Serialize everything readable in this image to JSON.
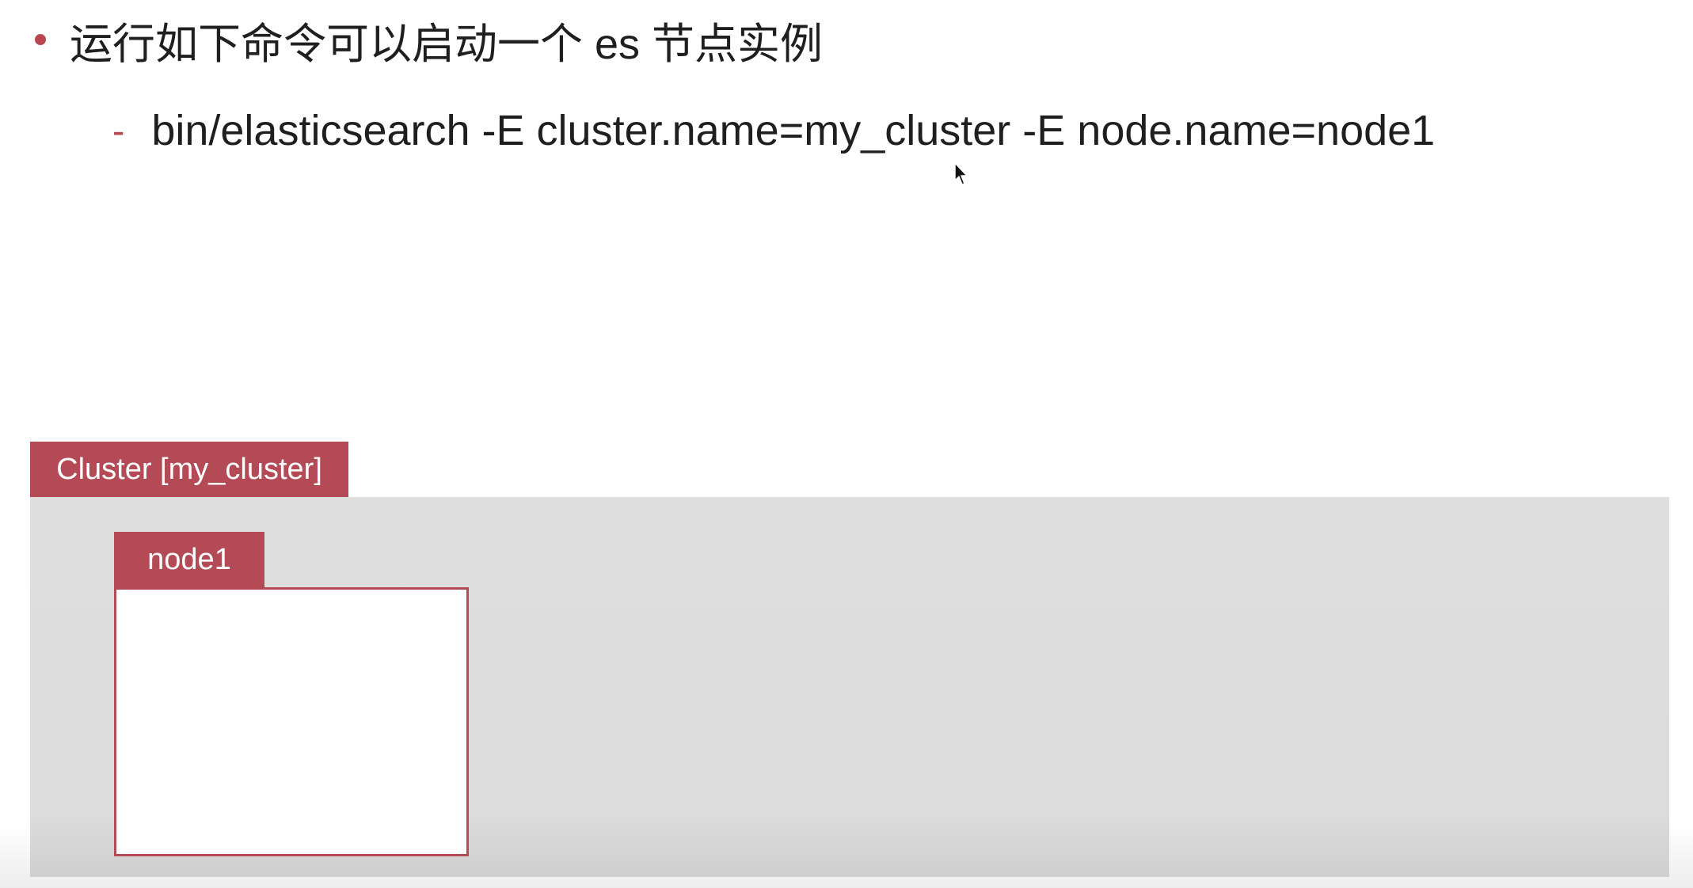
{
  "slide": {
    "bullet_text": "运行如下命令可以启动一个 es 节点实例",
    "sub_dash": "-",
    "command_text": "bin/elasticsearch -E cluster.name=my_cluster -E node.name=node1"
  },
  "diagram": {
    "cluster_label": "Cluster [my_cluster]",
    "node_label": "node1"
  },
  "colors": {
    "accent": "#b44a55",
    "cluster_background": "#dddddd",
    "text": "#1f1f1f"
  },
  "icons": {
    "cursor": "mouse-pointer-icon"
  }
}
